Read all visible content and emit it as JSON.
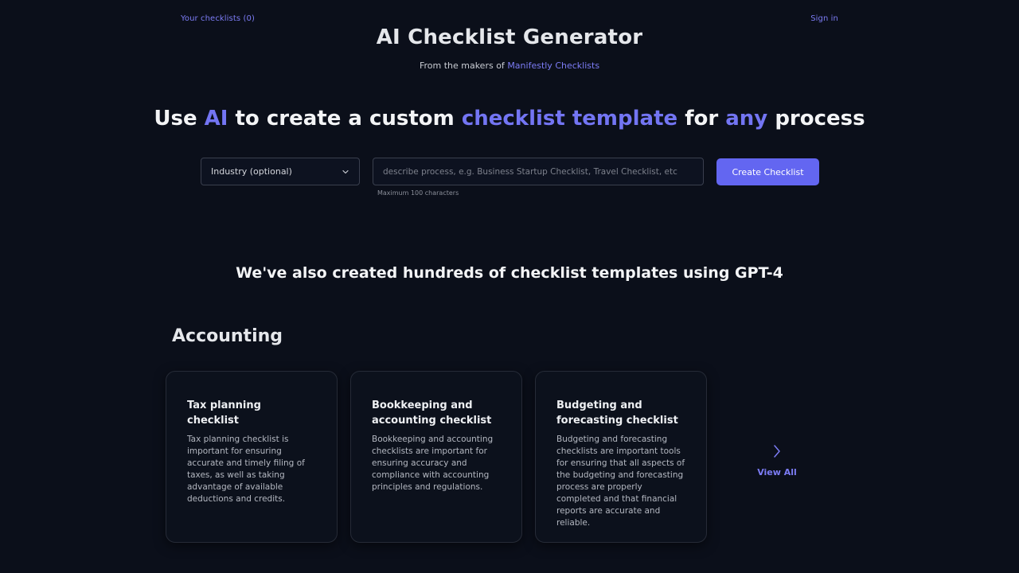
{
  "nav": {
    "checklists_link": "Your checklists (0)",
    "signin_link": "Sign in"
  },
  "brand": {
    "title": "AI Checklist Generator",
    "subtitle_prefix": "From the makers of ",
    "subtitle_link": "Manifestly Checklists"
  },
  "hero": {
    "part1": "Use ",
    "accent1": "AI",
    "part2": " to create a custom ",
    "accent2": "checklist template",
    "part3": " for ",
    "accent3": "any",
    "part4": " process"
  },
  "form": {
    "industry_select_value": "Industry (optional)",
    "process_input_value": "",
    "process_input_placeholder": "describe process, e.g. Business Startup Checklist, Travel Checklist, etc",
    "hint": "Maximum 100 characters",
    "create_button": "Create Checklist"
  },
  "templates": {
    "heading": "We've also created hundreds of checklist templates using GPT-4",
    "category": "Accounting",
    "cards": [
      {
        "title": "Tax planning checklist",
        "description": "Tax planning checklist is important for ensuring accurate and timely filing of taxes, as well as taking advantage of available deductions and credits."
      },
      {
        "title": "Bookkeeping and accounting checklist",
        "description": "Bookkeeping and accounting checklists are important for ensuring accuracy and compliance with accounting principles and regulations."
      },
      {
        "title": "Budgeting and forecasting checklist",
        "description": "Budgeting and forecasting checklists are important tools for ensuring that all aspects of the budgeting and forecasting process are properly completed and that financial reports are accurate and reliable."
      }
    ],
    "view_all": "View All"
  },
  "colors": {
    "background": "#0b0f1a",
    "accent": "#6366f1",
    "link": "#7c7cf5"
  }
}
